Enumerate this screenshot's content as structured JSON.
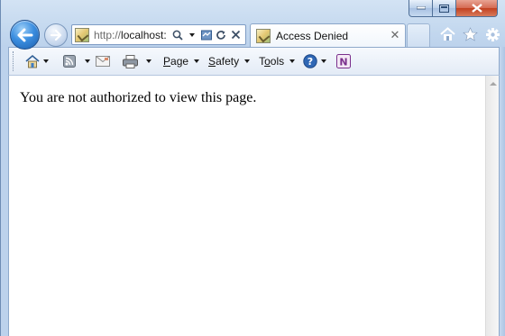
{
  "window": {
    "caption_buttons": [
      "minimize-icon",
      "maximize-icon",
      "close-icon"
    ]
  },
  "navigation": {
    "back_icon": "back-arrow-icon",
    "forward_icon": "forward-arrow-icon"
  },
  "address_bar": {
    "url_prefix": "http://",
    "url_host": "localhost:",
    "icons": [
      "search-icon",
      "dropdown-icon",
      "compatibility-icon",
      "refresh-icon",
      "stop-icon"
    ]
  },
  "tabs": [
    {
      "title": "Access Denied",
      "close_label": "✕"
    }
  ],
  "command_bar": {
    "items": [
      {
        "name": "home",
        "icon": "home-icon",
        "has_dropdown": true
      },
      {
        "name": "feeds",
        "icon": "rss-icon",
        "has_dropdown": true
      },
      {
        "name": "mail",
        "icon": "mail-icon",
        "has_dropdown": false
      },
      {
        "name": "print",
        "icon": "print-icon",
        "has_dropdown": true
      }
    ],
    "menus": {
      "page": {
        "label": "Page",
        "accel": "P"
      },
      "safety": {
        "label": "Safety",
        "accel": "S"
      },
      "tools": {
        "label": "Tools",
        "accel": "o"
      }
    },
    "help_icon": "help-icon",
    "onenote_icon": "onenote-icon"
  },
  "right_icons": [
    "home-icon",
    "favorites-star-icon",
    "tools-gear-icon"
  ],
  "page": {
    "message": "You are not authorized to view this page."
  },
  "colors": {
    "frame": "#c5d9ef",
    "back_button": "#3b8ee0",
    "close_button": "#c2401f"
  }
}
